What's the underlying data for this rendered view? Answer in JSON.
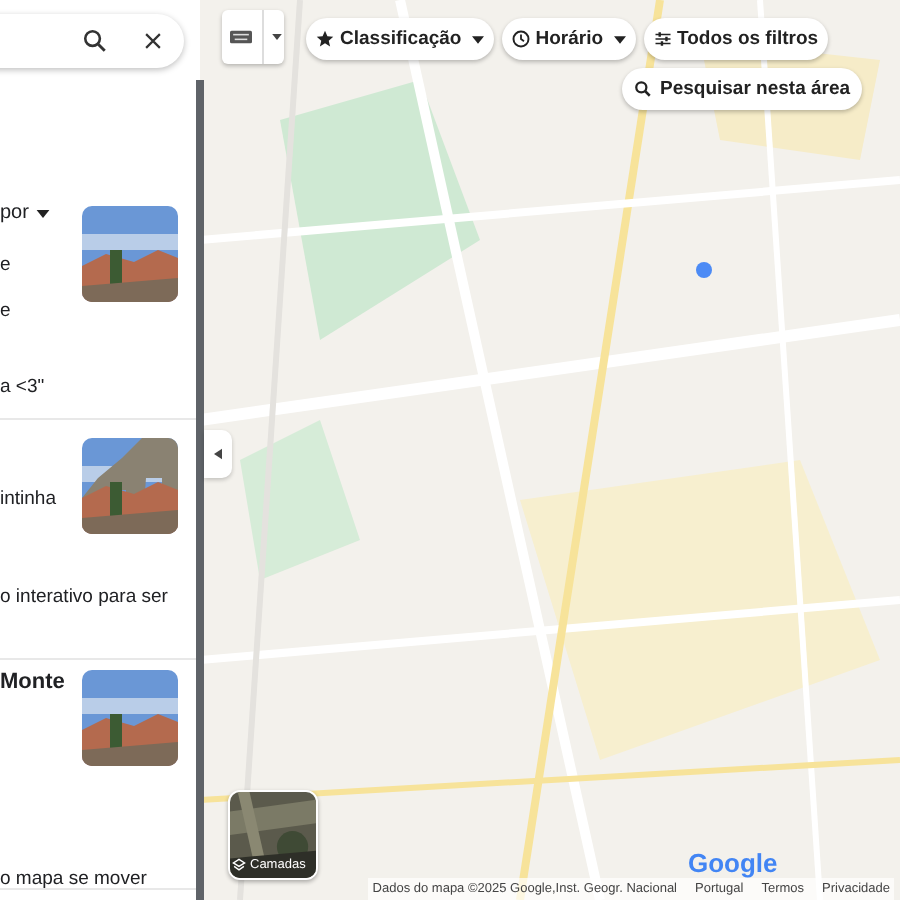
{
  "sort": {
    "label": "por"
  },
  "results": [
    {
      "lines": [
        "e",
        "e",
        "a <3\""
      ],
      "picture": {
        "kind": "picture"
      }
    },
    {
      "lines": [
        "intinha",
        "o interativo para ser"
      ],
      "picture": {
        "kind": "picture"
      }
    },
    {
      "title": "Monte",
      "picture": {
        "kind": "picture"
      }
    }
  ],
  "panel_footer": {
    "label": "o mapa se mover"
  },
  "filter_chips": [
    {
      "label": "Classificação",
      "dropdown": true
    },
    {
      "label": "Horário",
      "dropdown": true
    },
    {
      "label": "Todos os filtros",
      "dropdown": false
    }
  ],
  "search_area_button": {
    "label": "Pesquisar nesta área"
  },
  "layers_button": {
    "label": "Camadas"
  },
  "logo": "Google",
  "attribution": [
    "Dados do mapa ©2025 Google,Inst. Geogr. Nacional",
    "Portugal",
    "Termos",
    "Privacidade"
  ]
}
